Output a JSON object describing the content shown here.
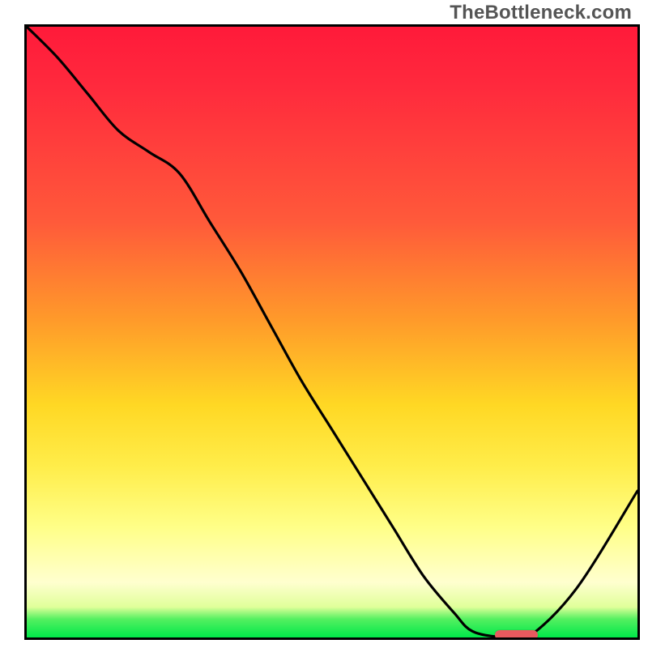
{
  "watermark": "TheBottleneck.com",
  "chart_data": {
    "type": "line",
    "title": "",
    "xlabel": "",
    "ylabel": "",
    "xlim": [
      0,
      100
    ],
    "ylim": [
      0,
      100
    ],
    "x": [
      0,
      5,
      10,
      15,
      20,
      25,
      30,
      35,
      40,
      45,
      50,
      55,
      60,
      65,
      70,
      73,
      78,
      82,
      90,
      100
    ],
    "values": [
      100,
      95,
      89,
      83,
      79.5,
      76,
      68,
      60,
      51,
      42,
      34,
      26,
      18,
      10,
      4,
      1,
      0,
      0,
      8,
      24
    ],
    "gradient_stops": [
      {
        "pct": 0,
        "color": "#ff1a3a"
      },
      {
        "pct": 32,
        "color": "#ff5a3a"
      },
      {
        "pct": 62,
        "color": "#ffd824"
      },
      {
        "pct": 82,
        "color": "#ffff88"
      },
      {
        "pct": 95,
        "color": "#e0ff9a"
      },
      {
        "pct": 100,
        "color": "#00e84a"
      }
    ],
    "optimal_marker": {
      "x_start": 76,
      "x_end": 83,
      "y": 0,
      "color": "#e85a5f"
    }
  }
}
